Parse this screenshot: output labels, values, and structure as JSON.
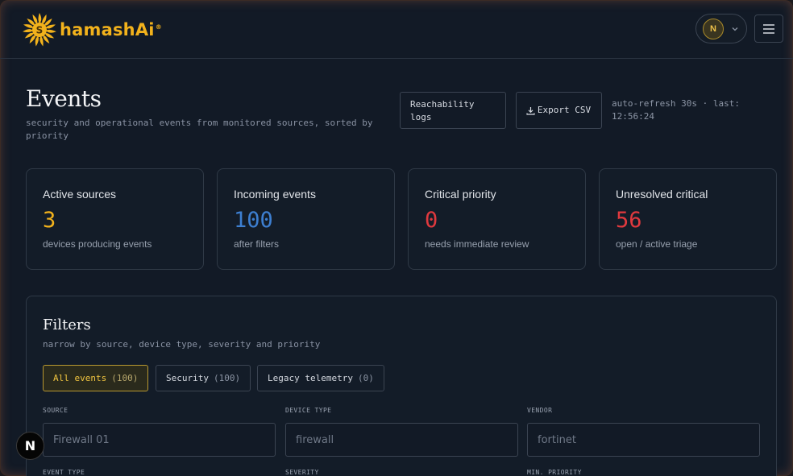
{
  "brand": {
    "name": "hamashAi",
    "trademark": "®"
  },
  "header": {
    "avatar_initial": "N"
  },
  "page": {
    "title": "Events",
    "subtitle": "security and operational events from monitored sources, sorted by priority",
    "reachability_label": "Reachability logs",
    "export_label": "Export CSV",
    "refresh_text": "auto-refresh 30s · last: 12:56:24"
  },
  "stats": [
    {
      "title": "Active sources",
      "value": "3",
      "sub": "devices producing events",
      "color": "#f2b21c"
    },
    {
      "title": "Incoming events",
      "value": "100",
      "sub": "after filters",
      "color": "#3d7fd1"
    },
    {
      "title": "Critical priority",
      "value": "0",
      "sub": "needs immediate review",
      "color": "#e0393e"
    },
    {
      "title": "Unresolved critical",
      "value": "56",
      "sub": "open / active triage",
      "color": "#e0393e"
    }
  ],
  "filters": {
    "title": "Filters",
    "subtitle": "narrow by source, device type, severity and priority",
    "chips": [
      {
        "label": "All events",
        "count": "(100)"
      },
      {
        "label": "Security",
        "count": "(100)"
      },
      {
        "label": "Legacy telemetry",
        "count": "(0)"
      }
    ],
    "fields": [
      {
        "label": "SOURCE",
        "placeholder": "Firewall 01"
      },
      {
        "label": "DEVICE TYPE",
        "placeholder": "firewall"
      },
      {
        "label": "VENDOR",
        "placeholder": "fortinet"
      },
      {
        "label": "EVENT TYPE"
      },
      {
        "label": "SEVERITY"
      },
      {
        "label": "MIN. PRIORITY"
      }
    ]
  },
  "fab": {
    "label": "N"
  }
}
